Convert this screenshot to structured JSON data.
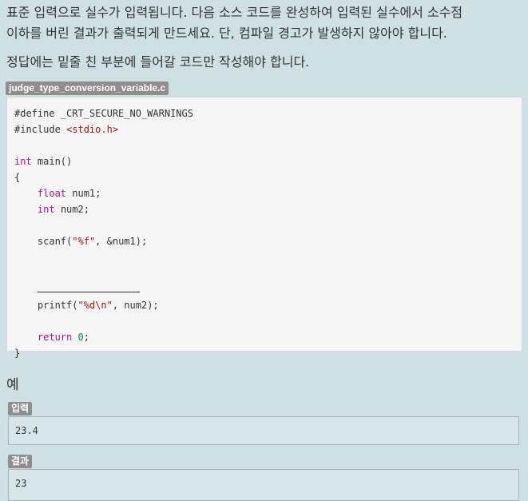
{
  "problem": {
    "line1": "표준 입력으로 실수가 입력됩니다. 다음 소스 코드를 완성하여 입력된 실수에서 소수점",
    "line2": "이하를 버린 결과가 출력되게 만드세요. 단, 컴파일 경고가 발생하지 않아야 합니다.",
    "instruction": "정답에는 밑줄 친 부분에 들어갈 코드만 작성해야 합니다."
  },
  "code": {
    "filename": "judge_type_conversion_variable.c",
    "define": "#define _CRT_SECURE_NO_WARNINGS",
    "include_directive": "#include ",
    "include_header": "<stdio.h>",
    "kw_int": "int",
    "main_sig": " main()",
    "open_brace": "{",
    "kw_float": "float",
    "num1_decl": " num1;",
    "num2_decl": " num2;",
    "scanf_call": "scanf(",
    "scanf_fmt": "\"%f\"",
    "scanf_args": ", &num1);",
    "printf_call": "printf(",
    "printf_fmt": "\"%d\\n\"",
    "printf_args": ", num2);",
    "kw_return": "return",
    "return_value": "0",
    "semicolon": ";",
    "close_brace": "}"
  },
  "example": {
    "heading": "예",
    "input_label": "입력",
    "input_value": "23.4",
    "output_label": "결과",
    "output_value": "23"
  },
  "colors": {
    "background": "#cfe0e5",
    "keyword": "#a31590",
    "string": "#a31515",
    "number": "#098658",
    "tag": "#8e8e8e"
  }
}
